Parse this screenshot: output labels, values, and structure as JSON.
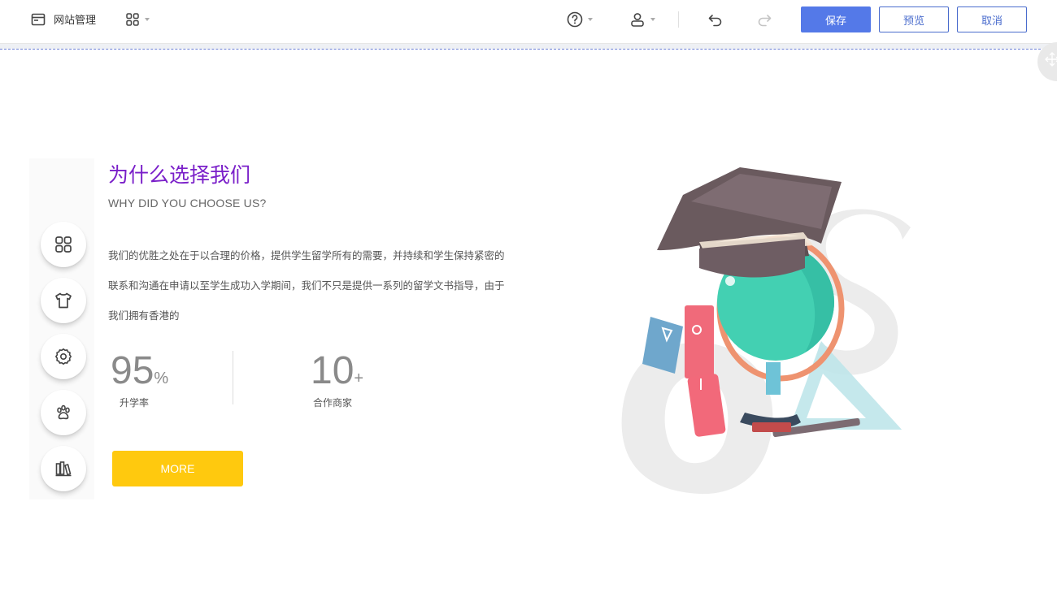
{
  "toolbar": {
    "site_manage_label": "网站管理",
    "save_label": "保存",
    "preview_label": "预览",
    "cancel_label": "取消"
  },
  "icons": {
    "site": "browser-window-icon",
    "apps": "grid-apps-icon",
    "help": "question-circle-icon",
    "user": "user-icon",
    "undo": "undo-icon",
    "redo": "redo-icon",
    "drag": "move-arrows-icon",
    "side": [
      "grid-apps-icon",
      "tshirt-icon",
      "gear-icon",
      "paw-icon",
      "library-icon"
    ]
  },
  "section": {
    "title": "为什么选择我们",
    "subtitle": "WHY DID YOU CHOOSE US?",
    "paragraph_lines": [
      "我们的优胜之处在于以合理的价格，提供学生留学所有的需要，并持续和学生保持紧密的",
      "联系和沟通在申请以至学生成功入学期间，我们不只是提供一系列的留学文书指导，由于",
      "我们拥有香港的"
    ],
    "stats": [
      {
        "number": "95",
        "suffix": "%",
        "label": "升学率"
      },
      {
        "number": "10",
        "suffix": "+",
        "label": "合作商家"
      }
    ],
    "more_label": "MORE"
  },
  "colors": {
    "primary": "#5479e8",
    "title": "#7a1fc9",
    "more": "#ffc90e"
  }
}
